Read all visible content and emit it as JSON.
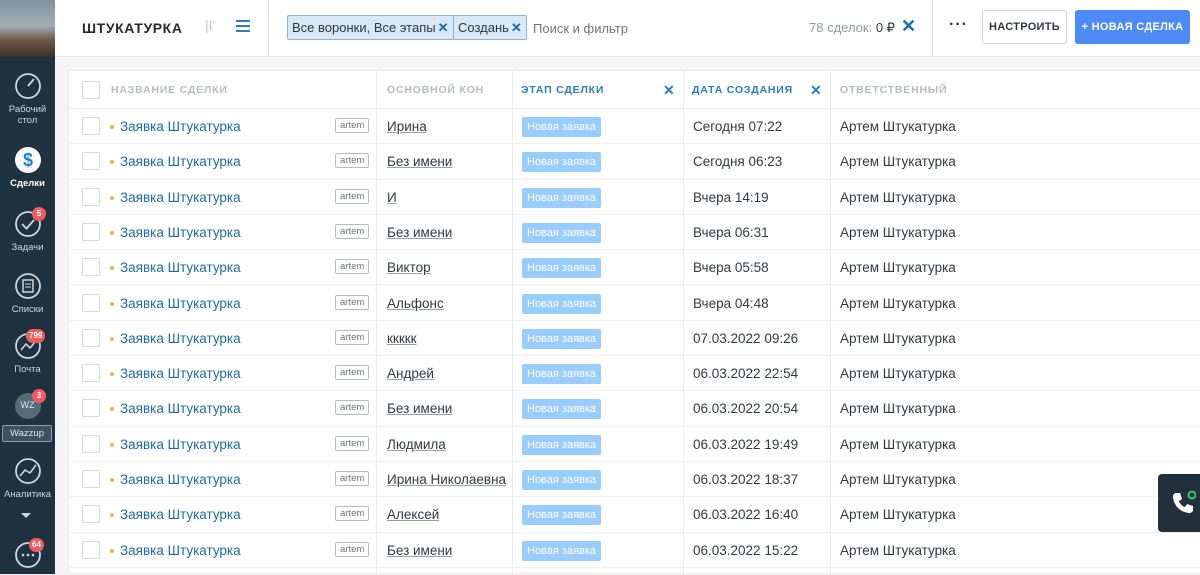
{
  "sidebar": {
    "items": [
      {
        "label": "Рабочий стол",
        "icon": "dashboard-icon"
      },
      {
        "label": "Сделки",
        "icon": "deals-icon",
        "active": true
      },
      {
        "label": "Задачи",
        "icon": "tasks-icon",
        "badge": "5"
      },
      {
        "label": "Списки",
        "icon": "lists-icon"
      },
      {
        "label": "Почта",
        "icon": "mail-icon",
        "badge": "799"
      },
      {
        "label": "Wazzup",
        "icon": "wazzup-icon",
        "badge": "3",
        "avatar_text": "WZ"
      },
      {
        "label": "Аналитика",
        "icon": "analytics-icon"
      },
      {
        "label": "",
        "icon": "chat-icon",
        "badge": "64"
      }
    ]
  },
  "header": {
    "title": "ШТУКАТУРКА",
    "view_toggle": "|I'",
    "filters": [
      "Все воронки, Все этапы",
      "Создань"
    ],
    "search_placeholder": "Поиск и фильтр",
    "count_text": "78 сделок:",
    "sum_text": "0 ₽",
    "more": "···",
    "config_label": "НАСТРОИТЬ",
    "new_deal_label": "+ НОВАЯ СДЕЛКА"
  },
  "table": {
    "columns": [
      "НАЗВАНИЕ СДЕЛКИ",
      "ОСНОВНОЙ КОН",
      "ЭТАП СДЕЛКИ",
      "ДАТА СОЗДАНИЯ",
      "ОТВЕТСТВЕННЫЙ"
    ],
    "rows": [
      {
        "name": "Заявка Штукатурка",
        "tag": "artem",
        "contact": "Ирина",
        "stage": "Новая заявка",
        "date": "Сегодня 07:22",
        "owner": "Артем Штукатурка"
      },
      {
        "name": "Заявка Штукатурка",
        "tag": "artem",
        "contact": "Без имени",
        "stage": "Новая заявка",
        "date": "Сегодня 06:23",
        "owner": "Артем Штукатурка"
      },
      {
        "name": "Заявка Штукатурка",
        "tag": "artem",
        "contact": "И",
        "stage": "Новая заявка",
        "date": "Вчера 14:19",
        "owner": "Артем Штукатурка"
      },
      {
        "name": "Заявка Штукатурка",
        "tag": "artem",
        "contact": "Без имени",
        "stage": "Новая заявка",
        "date": "Вчера 06:31",
        "owner": "Артем Штукатурка"
      },
      {
        "name": "Заявка Штукатурка",
        "tag": "artem",
        "contact": "Виктор",
        "stage": "Новая заявка",
        "date": "Вчера 05:58",
        "owner": "Артем Штукатурка"
      },
      {
        "name": "Заявка Штукатурка",
        "tag": "artem",
        "contact": "Альфонс",
        "stage": "Новая заявка",
        "date": "Вчера 04:48",
        "owner": "Артем Штукатурка"
      },
      {
        "name": "Заявка Штукатурка",
        "tag": "artem",
        "contact": "ккккк",
        "stage": "Новая заявка",
        "date": "07.03.2022 09:26",
        "owner": "Артем Штукатурка"
      },
      {
        "name": "Заявка Штукатурка",
        "tag": "artem",
        "contact": "Андрей",
        "stage": "Новая заявка",
        "date": "06.03.2022 22:54",
        "owner": "Артем Штукатурка"
      },
      {
        "name": "Заявка Штукатурка",
        "tag": "artem",
        "contact": "Без имени",
        "stage": "Новая заявка",
        "date": "06.03.2022 20:54",
        "owner": "Артем Штукатурка"
      },
      {
        "name": "Заявка Штукатурка",
        "tag": "artem",
        "contact": "Людмила",
        "stage": "Новая заявка",
        "date": "06.03.2022 19:49",
        "owner": "Артем Штукатурка"
      },
      {
        "name": "Заявка Штукатурка",
        "tag": "artem",
        "contact": "Ирина Николаевна",
        "stage": "Новая заявка",
        "date": "06.03.2022 18:37",
        "owner": "Артем Штукатурка"
      },
      {
        "name": "Заявка Штукатурка",
        "tag": "artem",
        "contact": "Алексей",
        "stage": "Новая заявка",
        "date": "06.03.2022 16:40",
        "owner": "Артем Штукатурка"
      },
      {
        "name": "Заявка Штукатурка",
        "tag": "artem",
        "contact": "Без имени",
        "stage": "Новая заявка",
        "date": "06.03.2022 15:22",
        "owner": "Артем Штукатурка"
      }
    ]
  },
  "colors": {
    "sidebar_bg": "#1f3240",
    "accent_blue": "#4c8bf5",
    "stage_badge": "#99ccff",
    "link": "#1f6aa5",
    "badge_red": "#f25b60"
  }
}
